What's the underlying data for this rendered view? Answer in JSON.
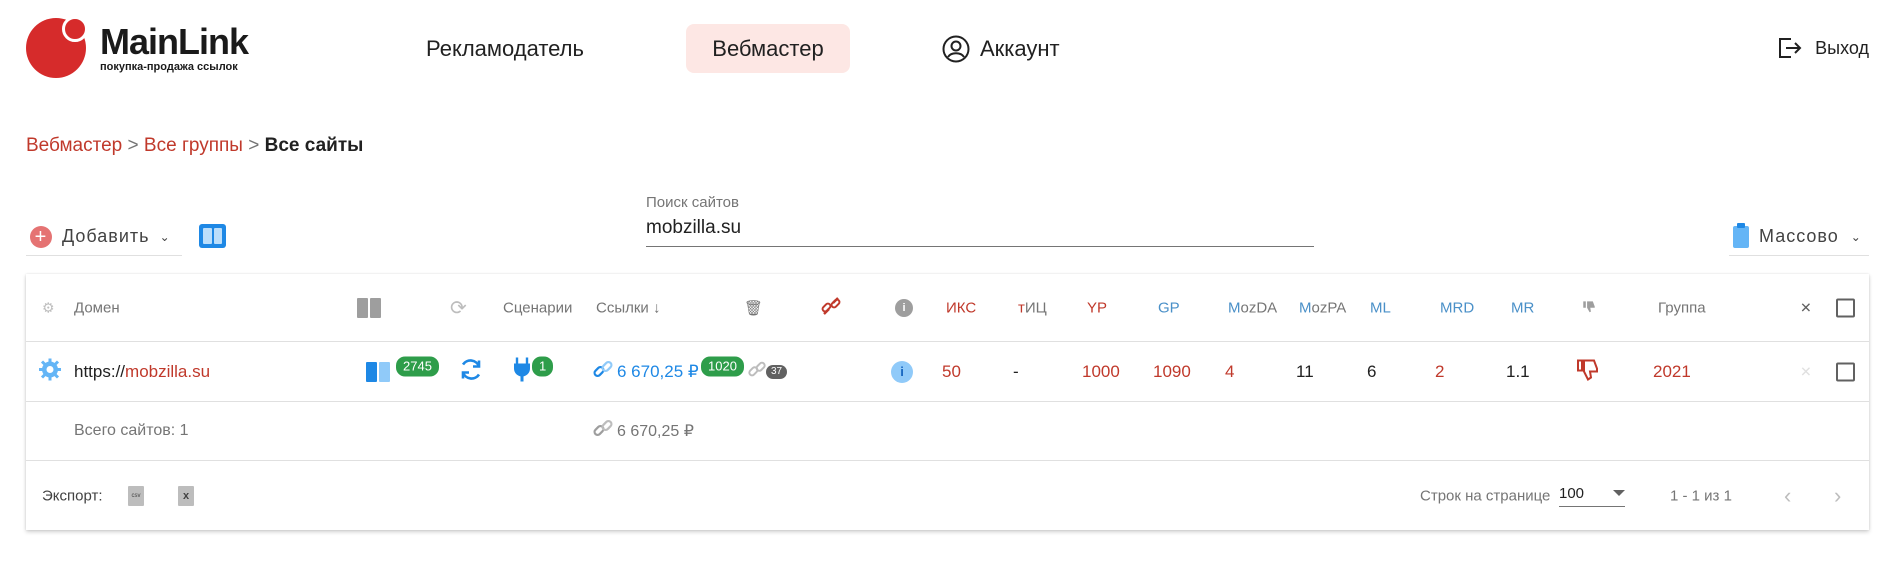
{
  "logo": {
    "name": "MainLink",
    "tagline": "покупка-продажа ссылок"
  },
  "nav": {
    "advertiser": "Рекламодатель",
    "webmaster": "Вебмастер",
    "account": "Аккаунт",
    "logout": "Выход"
  },
  "breadcrumb": {
    "items": [
      "Вебмастер",
      "Все группы"
    ],
    "separator": ">",
    "current": "Все сайты"
  },
  "toolbar": {
    "add_label": "Добавить",
    "search_label": "Поиск сайтов",
    "search_value": "mobzilla.su",
    "mass_label": "Массово"
  },
  "table": {
    "headers": {
      "domain": "Домен",
      "scenarios": "Сценарии",
      "links": "Ссылки",
      "iks": "ИКС",
      "tic_t": "т",
      "tic_rest": "ИЦ",
      "yr": "YP",
      "gr": "GP",
      "mozda_m": "M",
      "mozda_rest": "ozDA",
      "mozpa_m": "M",
      "mozpa_rest": "ozPA",
      "ml": "ML",
      "mrd": "MRD",
      "mr": "MR",
      "group": "Группа"
    },
    "rows": [
      {
        "domain_prefix": "https://",
        "domain_name": "mobzilla.su",
        "pages_badge": "2745",
        "scenarios_badge": "1",
        "links_amount": "6 670,25 ₽",
        "links_badge": "1020",
        "broken_badge": "37",
        "iks": "50",
        "tic": "-",
        "yr": "1000",
        "gr": "1090",
        "mozda": "4",
        "mozpa": "11",
        "ml": "6",
        "mrd": "2",
        "mr": "1.1",
        "group": "2021"
      }
    ],
    "total_label": "Всего сайтов: 1",
    "total_amount": "6 670,25 ₽"
  },
  "footer": {
    "export_label": "Экспорт:",
    "csv_label": "csv",
    "xls_label": "x",
    "rows_per_page_label": "Строк на странице",
    "rows_per_page_value": "100",
    "range": "1 - 1 из 1"
  },
  "colors": {
    "brand_red": "#d62b2b",
    "link_red": "#c0392b",
    "accent_blue": "#1e88e5",
    "badge_green": "#2e9d4a",
    "active_nav_bg": "#fde7e4"
  }
}
